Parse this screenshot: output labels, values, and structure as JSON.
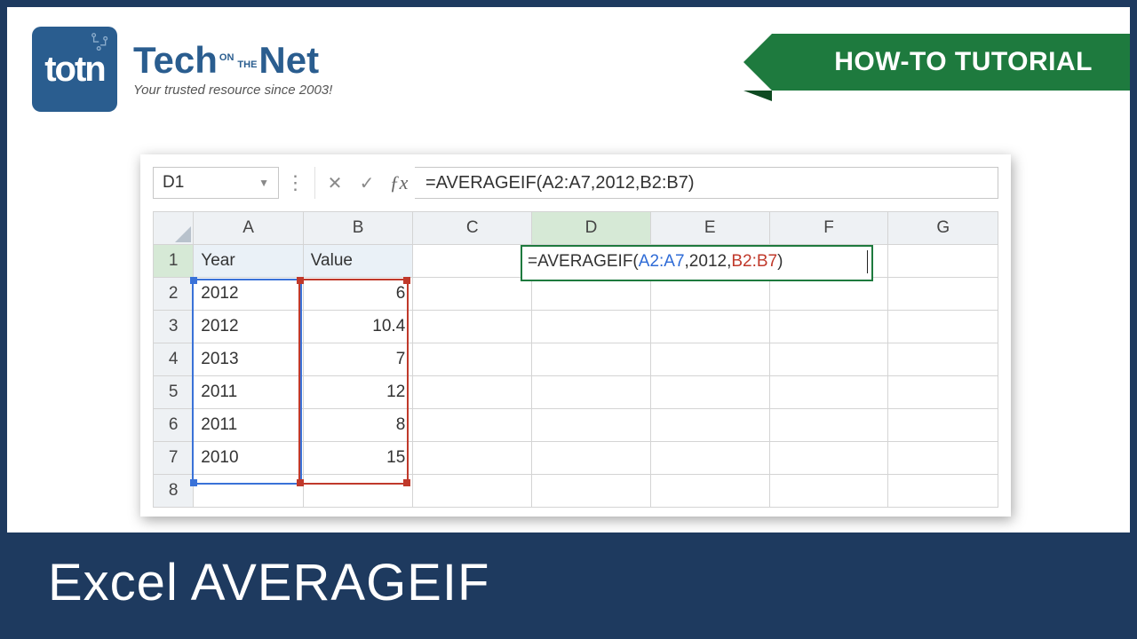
{
  "logo": {
    "square_text": "totn",
    "title_tech": "Tech",
    "title_small_on": "ON",
    "title_small_the": "THE",
    "title_net": "Net",
    "tagline": "Your trusted resource since 2003!"
  },
  "ribbon": {
    "label": "HOW-TO TUTORIAL"
  },
  "excel": {
    "namebox": "D1",
    "formula": "=AVERAGEIF(A2:A7,2012,B2:B7)",
    "columns": [
      "A",
      "B",
      "C",
      "D",
      "E",
      "F",
      "G"
    ],
    "row_nums": [
      "1",
      "2",
      "3",
      "4",
      "5",
      "6",
      "7",
      "8"
    ],
    "headers": {
      "A1": "Year",
      "B1": "Value"
    },
    "data": [
      {
        "year": "2012",
        "value": "6"
      },
      {
        "year": "2012",
        "value": "10.4"
      },
      {
        "year": "2013",
        "value": "7"
      },
      {
        "year": "2011",
        "value": "12"
      },
      {
        "year": "2011",
        "value": "8"
      },
      {
        "year": "2010",
        "value": "15"
      }
    ],
    "d1_display": {
      "prefix": "=AVERAGEIF(",
      "range_a": "A2:A7",
      "mid": ",2012,",
      "range_b": "B2:B7",
      "suffix": ")"
    }
  },
  "banner": {
    "text": "Excel AVERAGEIF"
  },
  "chart_data": {
    "type": "table",
    "title": "AVERAGEIF example data",
    "columns": [
      "Year",
      "Value"
    ],
    "rows": [
      [
        2012,
        6
      ],
      [
        2012,
        10.4
      ],
      [
        2013,
        7
      ],
      [
        2011,
        12
      ],
      [
        2011,
        8
      ],
      [
        2010,
        15
      ]
    ],
    "formula": "=AVERAGEIF(A2:A7,2012,B2:B7)"
  }
}
